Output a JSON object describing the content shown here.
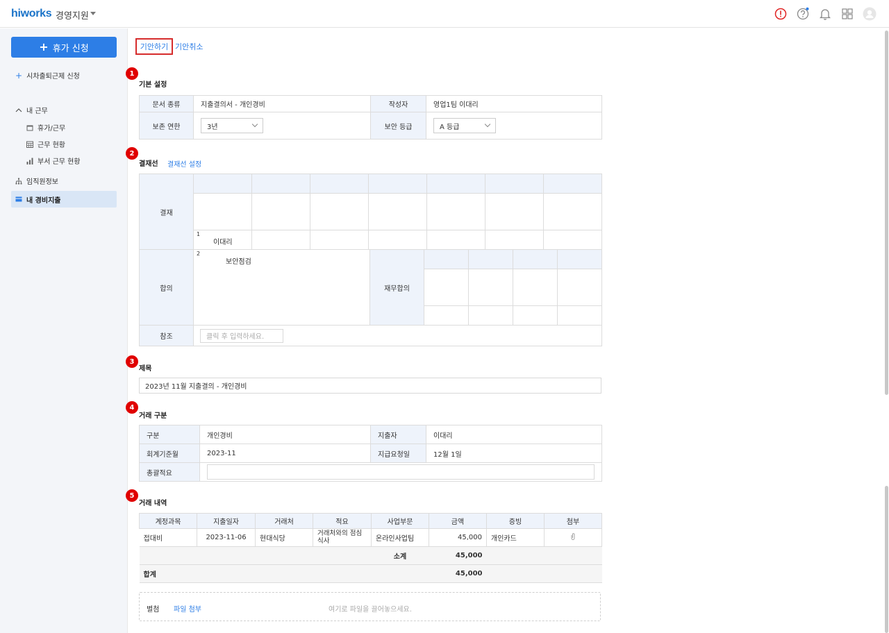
{
  "header": {
    "logo": "hiworks",
    "org": "경영지원",
    "icons": [
      "alert-icon",
      "help-icon",
      "bell-icon",
      "apps-grid-icon",
      "avatar"
    ]
  },
  "sidebar": {
    "primary_button": "휴가 신청",
    "attendance_link": "시차출퇴근제 신청",
    "my_work": "내 근무",
    "sub_items": [
      "휴가/근무",
      "근무 현황",
      "부서 근무 현황"
    ],
    "employee_info": "임직원정보",
    "active_item": "내 경비지출"
  },
  "toolbar": {
    "draft": "기안하기",
    "cancel": "기안취소"
  },
  "badges": [
    "1",
    "2",
    "3",
    "4",
    "5"
  ],
  "basic": {
    "title": "기본 설정",
    "doc_type_label": "문서 종류",
    "doc_type_value": "지출결의서 - 개인경비",
    "author_label": "작성자",
    "author_value": "영업1팀 이대리",
    "retention_label": "보존 연한",
    "retention_value": "3년",
    "security_label": "보안 등급",
    "security_value": "A 등급"
  },
  "approval": {
    "title": "결재선",
    "setting_link": "결재선 설정",
    "approve_label": "결재",
    "approver_index": "1",
    "approver_name": "이대리",
    "agree_label": "합의",
    "agree_index": "2",
    "agree_name": "보안점검",
    "finance_label": "재무합의",
    "ref_label": "참조",
    "ref_placeholder": "클릭 후 입력하세요."
  },
  "subject": {
    "title": "제목",
    "value": "2023년 11월 지출결의 - 개인경비"
  },
  "transaction_type": {
    "title": "거래 구분",
    "category_label": "구분",
    "category_value": "개인경비",
    "spender_label": "지출자",
    "spender_value": "이대리",
    "period_label": "회계기준월",
    "period_value": "2023-11",
    "request_date_label": "지급요청일",
    "request_date_value": "12월 1일",
    "summary_label": "총괄적요",
    "summary_value": ""
  },
  "details": {
    "title": "거래 내역",
    "columns": [
      "계정과목",
      "지출일자",
      "거래처",
      "적요",
      "사업부문",
      "금액",
      "증빙",
      "첨부"
    ],
    "row": {
      "account": "접대비",
      "date": "2023-11-06",
      "vendor": "현대식당",
      "memo": "거래처와의 점심식사",
      "division": "온라인사업팀",
      "amount": "45,000",
      "proof": "개인카드"
    },
    "subtotal_label": "소계",
    "subtotal_value": "45,000",
    "total_label": "합계",
    "total_value": "45,000"
  },
  "attachment": {
    "label": "별첨",
    "link": "파일 첨부",
    "drop_hint": "여기로 파일을 끌어놓으세요."
  }
}
